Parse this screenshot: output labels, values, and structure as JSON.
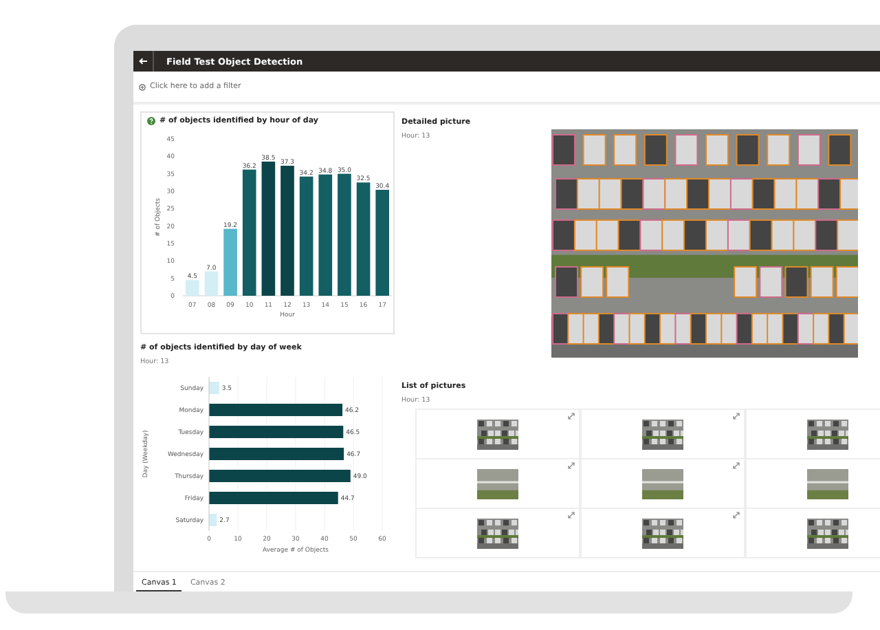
{
  "window": {
    "title": "Field Test Object Detection"
  },
  "filter_bar": {
    "placeholder": "Click here to add a filter"
  },
  "hour_chart": {
    "title": "# of objects identified by hour of day",
    "chart_data": {
      "type": "bar",
      "xlabel": "Hour",
      "ylabel": "# of Objects",
      "categories": [
        "07",
        "08",
        "09",
        "10",
        "11",
        "12",
        "13",
        "14",
        "15",
        "16",
        "17"
      ],
      "values": [
        4.5,
        7.0,
        19.2,
        36.2,
        38.5,
        37.3,
        34.2,
        34.8,
        35.0,
        32.5,
        30.4
      ],
      "ylim": [
        0,
        45
      ],
      "yticks": [
        0,
        5,
        10,
        15,
        20,
        25,
        30,
        35,
        40,
        45
      ],
      "value_labels": [
        "4.5",
        "7.0",
        "19.2",
        "36.2",
        "38.5",
        "37.3",
        "34.2",
        "34.8",
        "35.0",
        "32.5",
        "30.4"
      ]
    }
  },
  "day_chart": {
    "title": "# of objects identified by day of week",
    "subtitle": "Hour: 13",
    "chart_data": {
      "type": "bar",
      "orientation": "horizontal",
      "xlabel": "Average # of Objects",
      "ylabel": "Day (Weekday)",
      "categories": [
        "Sunday",
        "Monday",
        "Tuesday",
        "Wednesday",
        "Thursday",
        "Friday",
        "Saturday"
      ],
      "values": [
        3.5,
        46.2,
        46.5,
        46.7,
        49.0,
        44.7,
        2.7
      ],
      "xlim": [
        0,
        60
      ],
      "xticks": [
        0,
        10,
        20,
        30,
        40,
        50,
        60
      ],
      "grid": true,
      "value_labels": [
        "3.5",
        "46.2",
        "46.5",
        "46.7",
        "49.0",
        "44.7",
        "2.7"
      ]
    }
  },
  "detailed_picture": {
    "title": "Detailed picture",
    "subtitle": "Hour: 13"
  },
  "picture_list": {
    "title": "List of pictures",
    "subtitle": "Hour: 13",
    "pictures": [
      {
        "kind": "parking",
        "expandable": true
      },
      {
        "kind": "parking",
        "expandable": true
      },
      {
        "kind": "parking",
        "expandable": false
      },
      {
        "kind": "road",
        "expandable": true
      },
      {
        "kind": "road",
        "expandable": true
      },
      {
        "kind": "road",
        "expandable": false
      },
      {
        "kind": "parking",
        "expandable": true
      },
      {
        "kind": "parking",
        "expandable": true
      },
      {
        "kind": "parking",
        "expandable": false
      }
    ]
  },
  "tabs": [
    {
      "label": "Canvas 1",
      "selected": true
    },
    {
      "label": "Canvas 2",
      "selected": false
    }
  ]
}
